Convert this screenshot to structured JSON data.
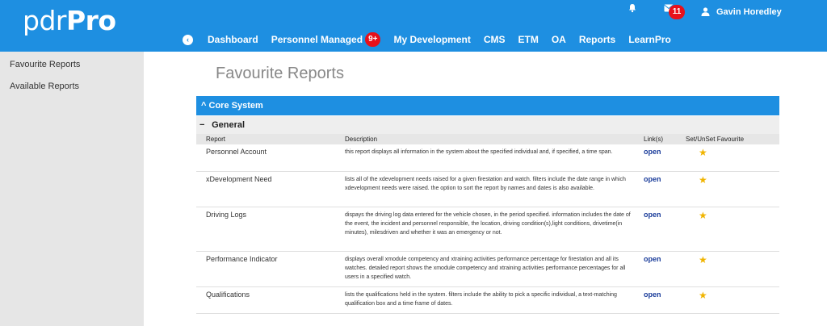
{
  "header": {
    "logo_light": "pdr",
    "logo_bold": "Pro",
    "mail_count": "11",
    "user_name": "Gavin Horedley",
    "nav": [
      {
        "label": "Dashboard"
      },
      {
        "label": "Personnel Managed",
        "badge": "9+"
      },
      {
        "label": "My Development"
      },
      {
        "label": "CMS"
      },
      {
        "label": "ETM"
      },
      {
        "label": "OA"
      },
      {
        "label": "Reports"
      },
      {
        "label": "LearnPro"
      }
    ],
    "back_icon": "‹"
  },
  "sidebar": {
    "items": [
      {
        "label": "Favourite Reports"
      },
      {
        "label": "Available Reports"
      }
    ]
  },
  "main": {
    "title": "Favourite  Reports",
    "section_label": "Core System",
    "section_chevron": "^",
    "group_label": "General",
    "group_toggle": "−",
    "columns": [
      "Report",
      "Description",
      "Link(s)",
      "Set/UnSet Favourite"
    ],
    "rows": [
      {
        "name": "Personnel Account",
        "desc": "this report displays all information in the system about the specified individual and, if specified, a time span.",
        "link": "open"
      },
      {
        "name": "xDevelopment Need",
        "desc": "lists all of the xdevelopment needs raised for a given firestation and watch. filters include the date range in which xdevelopment needs were raised. the option to sort the report by names and dates is also available.",
        "link": "open"
      },
      {
        "name": "Driving Logs",
        "desc": "dispays the driving log data entered for the vehicle chosen, in the period specified. information includes the date of the event, the incident and personnel responsible, the location, driving condition(s),light conditions, drivetime(in minutes), milesdriven and whether it was an emergency or not.",
        "link": "open"
      },
      {
        "name": "Performance Indicator",
        "desc": "displays overall xmodule competency and xtraining activities performance percentage for firestation and all its watches. detailed report shows the xmodule competency and xtraining activities performance percentages for all users in a specified watch.",
        "link": "open"
      },
      {
        "name": "Qualifications",
        "desc": "lists the qualifications held in the system. filters include the ability to pick a specific individual, a text-matching qualification box and a time frame of dates.",
        "link": "open"
      }
    ],
    "star_glyph": "★"
  },
  "colors": {
    "brand_blue": "#1e8fe1",
    "badge_red": "#e8101a",
    "star_gold": "#f0b400",
    "link_blue": "#1a3c9a"
  }
}
